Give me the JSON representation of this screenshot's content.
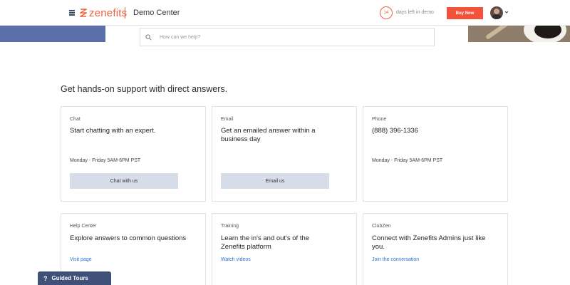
{
  "header": {
    "logo_text": "zenefits",
    "section_title": "Demo Center",
    "days_left_count": "14",
    "days_left_text": "days left in demo",
    "buy_button": "Buy Now"
  },
  "search": {
    "placeholder": "How can we help?"
  },
  "main": {
    "heading": "Get hands-on support with direct answers.",
    "cards": [
      {
        "label": "Chat",
        "title": "Start chatting with an expert.",
        "hours": "Monday - Friday 5AM-6PM PST",
        "action": "Chat with us"
      },
      {
        "label": "Email",
        "title": "Get an emailed answer within a business day",
        "action": "Email us"
      },
      {
        "label": "Phone",
        "title": "(888) 396-1336",
        "hours": "Monday - Friday 5AM-6PM PST"
      },
      {
        "label": "Help Center",
        "title": "Explore answers to common questions",
        "link": "Visit page"
      },
      {
        "label": "Training",
        "title": "Learn the in's and out's of the Zenefits platform",
        "link": "Watch videos"
      },
      {
        "label": "ClubZen",
        "title": "Connect with Zenefits Admins just like you.",
        "link": "Join the conversation"
      }
    ]
  },
  "footer": {
    "guided_tours": "Guided Tours"
  },
  "colors": {
    "brand": "#f2613f",
    "buy_button": "#f2513a",
    "link": "#2f6fcb",
    "action_button": "#d6dde8",
    "guided_tours_bg": "#3f5079"
  },
  "icons": [
    "menu-icon",
    "zenefits-logo-icon",
    "search-icon",
    "chevron-down-icon",
    "question-icon"
  ]
}
